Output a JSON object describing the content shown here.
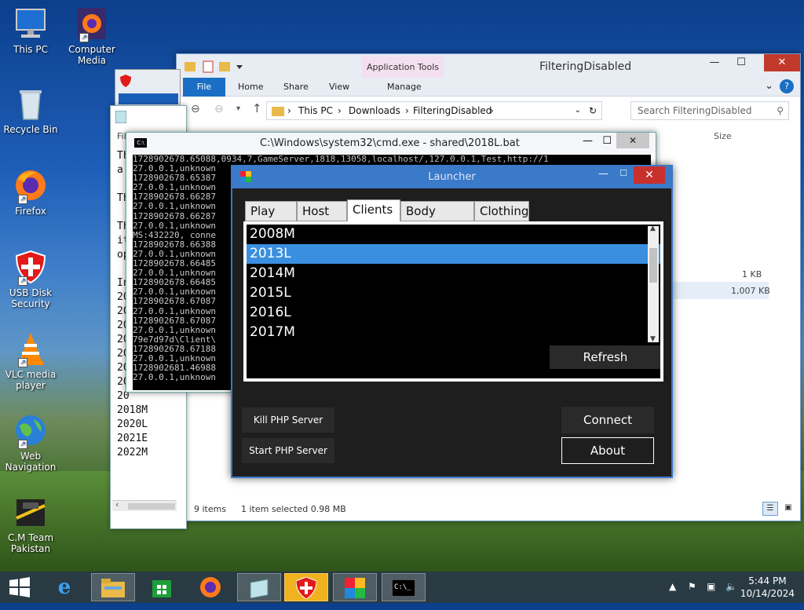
{
  "desktop": {
    "icons": [
      {
        "label": "This PC",
        "icon": "computer-icon"
      },
      {
        "label": "Computer Media",
        "icon": "firefox-icon"
      },
      {
        "label": "Recycle Bin",
        "icon": "recycle-bin-icon"
      },
      {
        "label": "Firefox",
        "icon": "firefox-icon"
      },
      {
        "label": "USB Disk Security",
        "icon": "shield-icon"
      },
      {
        "label": "VLC media player",
        "icon": "vlc-icon"
      },
      {
        "label": "Web Navigation",
        "icon": "globe-icon"
      },
      {
        "label": "C.M Team Pakistan",
        "icon": "cm-team-icon"
      }
    ]
  },
  "explorer": {
    "title": "FilteringDisabled",
    "app_tools": "Application Tools",
    "ribbon": {
      "file": "File",
      "home": "Home",
      "share": "Share",
      "view": "View",
      "manage": "Manage"
    },
    "breadcrumb": [
      "This PC",
      "Downloads",
      "FilteringDisabled"
    ],
    "search_placeholder": "Search FilteringDisabled",
    "col_size": "Size",
    "sizes": [
      "1 KB",
      "1,007 KB"
    ],
    "partial_text": "ent",
    "status": {
      "items": "9 items",
      "selected": "1 item selected  0.98 MB"
    }
  },
  "notepad": {
    "lines": [
      "Th",
      "a ",
      "",
      "Th",
      "",
      "Th",
      "it",
      "op",
      "",
      "In",
      "20",
      "20",
      "20",
      "20",
      "20",
      "20",
      "20",
      "20",
      "2018M",
      "2020L",
      "2021E",
      "2022M"
    ],
    "menu": "Fil"
  },
  "cmd": {
    "title": "C:\\Windows\\system32\\cmd.exe - shared\\2018L.bat",
    "lines": [
      "1728902678.65088,0934,7,GameServer,1818,13058,localhost/,127.0.0.1,Test,http://1",
      "27.0.0.1,unknown",
      "1728902678.65387",
      "27.0.0.1,unknown",
      "1728902678.66287",
      "27.0.0.1,unknown",
      "1728902678.66287",
      "27.0.0.1,unknown",
      "MS:432220, conne",
      "1728902678.66388",
      "27.0.0.1,unknown",
      "1728902678.66485",
      "27.0.0.1,unknown",
      "1728902678.66485",
      "27.0.0.1,unknown",
      "1728902678.67087",
      "27.0.0.1,unknown",
      "1728902678.67087",
      "27.0.0.1,unknown",
      "79e7d97d\\Client\\",
      "1728902678.67188",
      "27.0.0.1,unknown",
      "1728902681.46988",
      "27.0.0.1,unknown"
    ]
  },
  "launcher": {
    "title": "Launcher",
    "tabs": [
      "Play",
      "Host",
      "Clients",
      "Body Colors",
      "Clothing"
    ],
    "active_tab": "Clients",
    "clients": [
      "2008M",
      "2013L",
      "2014M",
      "2015L",
      "2016L",
      "2017M"
    ],
    "selected_client": "2013L",
    "refresh": "Refresh",
    "kill_php": "Kill PHP Server",
    "start_php": "Start PHP Server",
    "connect": "Connect",
    "about": "About"
  },
  "taskbar": {
    "time": "5:44 PM",
    "date": "10/14/2024"
  }
}
